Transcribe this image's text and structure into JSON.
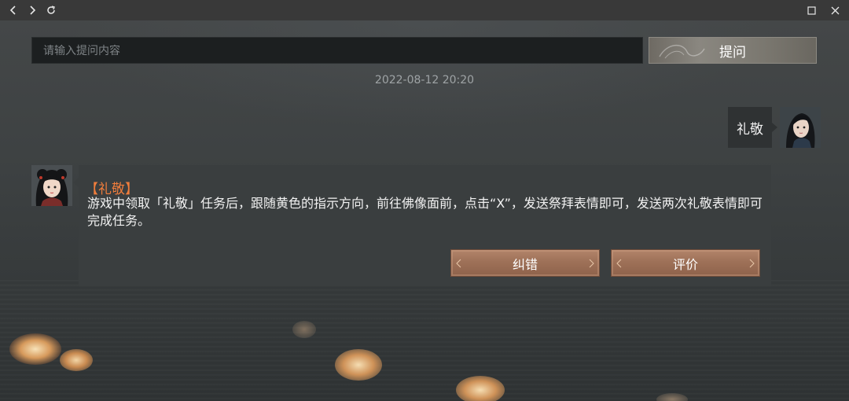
{
  "window": {
    "back_icon": "chevron-left-icon",
    "forward_icon": "chevron-right-icon",
    "refresh_icon": "refresh-icon",
    "maximize_icon": "maximize-icon",
    "close_icon": "close-icon"
  },
  "search": {
    "placeholder": "请输入提问内容",
    "value": "",
    "button_label": "提问"
  },
  "chat": {
    "timestamp": "2022-08-12 20:20",
    "user_message": "礼敬",
    "answer": {
      "title": "【礼敬】",
      "body": "游戏中领取「礼敬」任务后，跟随黄色的指示方向，前往佛像面前，点击“X”，发送祭拜表情即可，发送两次礼敬表情即可完成任务。",
      "correct_label": "纠错",
      "rate_label": "评价"
    }
  },
  "colors": {
    "accent_title": "#f07d3c",
    "action_button": "#9e7158",
    "bubble_bg": "#2f3233"
  }
}
